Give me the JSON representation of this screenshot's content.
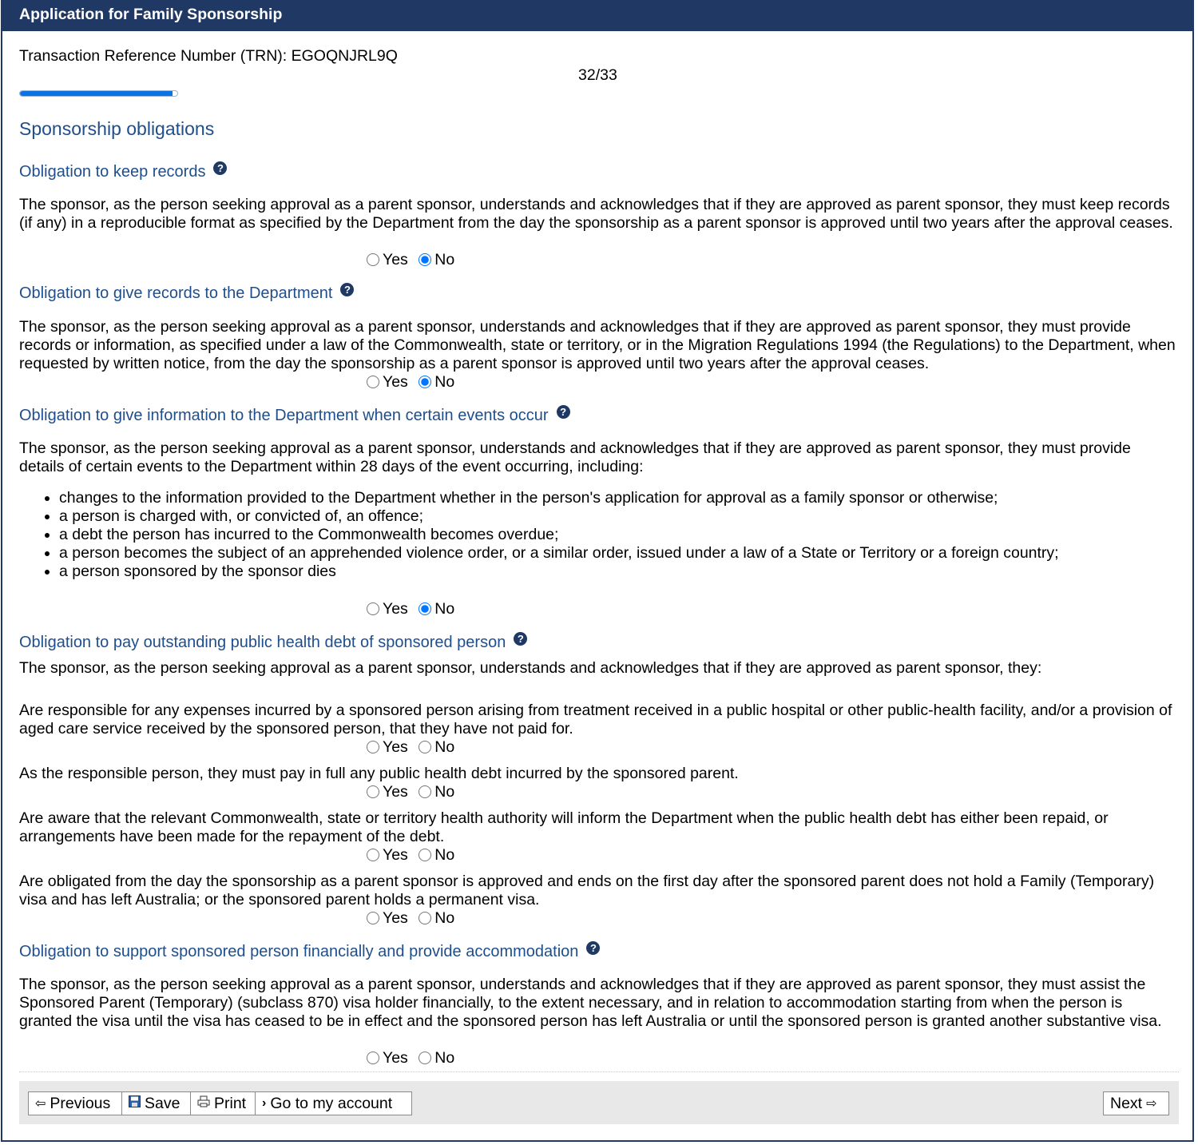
{
  "window": {
    "title": "Application for Family Sponsorship"
  },
  "header": {
    "trn": "Transaction Reference Number (TRN): EGOQNJRL9Q",
    "page_count": "32/33",
    "progress_fraction": 0.97
  },
  "page_heading": "Sponsorship obligations",
  "radio_labels": {
    "yes": "Yes",
    "no": "No"
  },
  "sections": {
    "keep_records": {
      "heading": "Obligation to keep records",
      "text": "The sponsor, as the person seeking approval as a parent sponsor, understands and acknowledges that if they are approved as parent sponsor, they must keep records (if any) in a reproducible format as specified by the Department from the day the sponsorship as a parent sponsor is approved until two years after the approval ceases.",
      "answer": "No"
    },
    "give_records": {
      "heading": "Obligation to give records to the Department",
      "text": "The sponsor, as the person seeking approval as a parent sponsor, understands and acknowledges that if they are approved as parent sponsor, they must provide records or information, as specified under a law of the Commonwealth, state or territory, or in the Migration Regulations 1994 (the Regulations) to the Department, when requested by written notice, from the day the sponsorship as a parent sponsor is approved until two years after the approval ceases.",
      "answer": "No"
    },
    "give_information": {
      "heading": "Obligation to give information to the Department when certain events occur",
      "text": "The sponsor, as the person seeking approval as a parent sponsor, understands and acknowledges that if they are approved as parent sponsor, they must provide details of certain events to the Department within 28 days of the event occurring, including:",
      "events": [
        "changes to the information provided to the Department whether in the person's application for approval as a family sponsor or otherwise;",
        "a person is charged with, or convicted of, an offence;",
        "a debt the person has incurred to the Commonwealth becomes overdue;",
        "a person becomes the subject of an apprehended violence order, or a similar order, issued under a law of a State or Territory or a foreign country;",
        "a person sponsored by the sponsor dies"
      ],
      "answer": "No"
    },
    "health_debt": {
      "heading": "Obligation to pay outstanding public health debt of sponsored person",
      "intro": "The sponsor, as the person seeking approval as a parent sponsor, understands and acknowledges that if they are approved as parent sponsor, they:",
      "items": [
        "Are responsible for any expenses incurred by a sponsored person arising from treatment received in a public hospital or other public-health facility, and/or a provision of aged care service received by the sponsored person, that they have not paid for.",
        "As the responsible person, they must pay in full any public health debt incurred by the sponsored parent.",
        "Are aware that the relevant Commonwealth, state or territory health authority will inform the Department when the public health debt has either been repaid, or arrangements have been made for the repayment of the debt.",
        "Are obligated from the day the sponsorship as a parent sponsor is approved and ends on the first day after the sponsored parent does not hold a Family (Temporary) visa and has left Australia; or the sponsored parent holds a permanent visa."
      ]
    },
    "support": {
      "heading": "Obligation to support sponsored person financially and provide accommodation",
      "text": "The sponsor, as the person seeking approval as a parent sponsor, understands and acknowledges that if they are approved as parent sponsor, they must assist the Sponsored Parent (Temporary) (subclass 870) visa holder financially, to the extent necessary, and in relation to accommodation starting from when the person is granted the visa until the visa has ceased to be in effect and the sponsored person has left Australia or until the sponsored person is granted another substantive visa."
    }
  },
  "footer": {
    "previous": "Previous",
    "save": "Save",
    "print": "Print",
    "account": "Go to my account",
    "next": "Next"
  },
  "colors": {
    "header_bg": "#1f3864",
    "heading_text": "#1f4e8c",
    "progress": "#0a74e2"
  }
}
